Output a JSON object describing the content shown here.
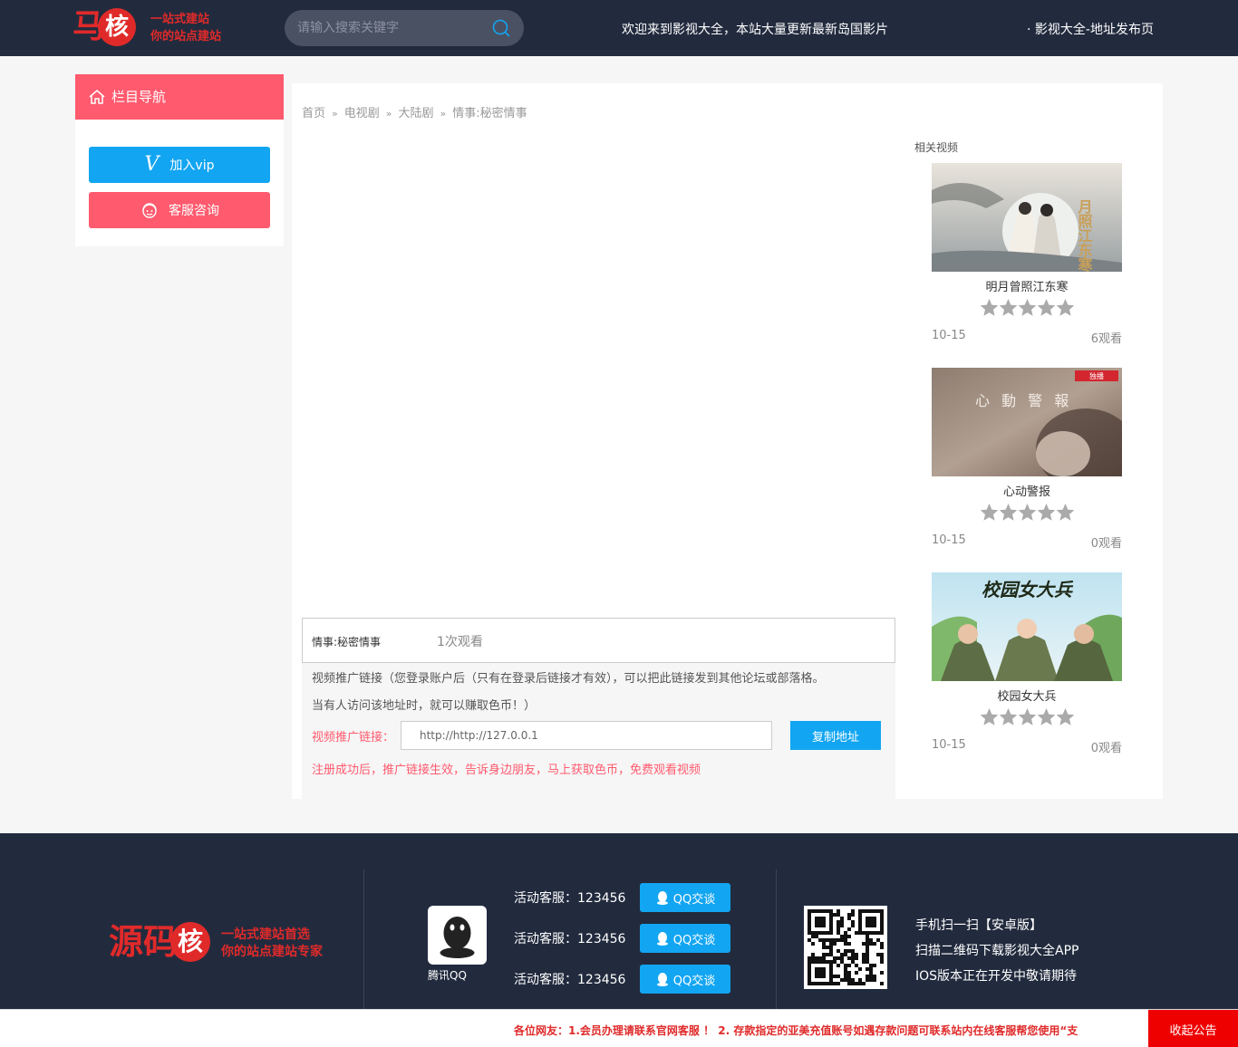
{
  "header": {
    "logo_char1": "马",
    "logo_char2": "核",
    "slogan1": "一站式建站",
    "slogan2": "你的站点建站",
    "search_placeholder": "请输入搜索关键字",
    "welcome": "欢迎来到影视大全，本站大量更新最新岛国影片",
    "release_link": "· 影视大全-地址发布页"
  },
  "sidebar": {
    "title": "栏目导航",
    "vip_button": "加入vip",
    "service_button": "客服咨询"
  },
  "breadcrumb": [
    "首页",
    "电视剧",
    "大陆剧",
    "情事:秘密情事"
  ],
  "video": {
    "title": "情事:秘密情事",
    "views": "1次观看"
  },
  "promo": {
    "line1": "视频推广链接（您登录账户后（只有在登录后链接才有效），可以把此链接发到其他论坛或部落格。",
    "line2": "当有人访问该地址时，就可以赚取色币！）",
    "label": "视频推广链接：",
    "url": "http://http://127.0.0.1",
    "copy_button": "复制地址",
    "note": "注册成功后，推广链接生效，告诉身边朋友，马上获取色币，免费观看视频"
  },
  "related": {
    "title": "相关视频",
    "items": [
      {
        "name": "明月曾照江东寒",
        "date": "10-15",
        "views": "6观看",
        "poster_text": "月照江东寒",
        "rating": 0
      },
      {
        "name": "心动警报",
        "date": "10-15",
        "views": "0观看",
        "poster_text": "心 動 警 報",
        "rating": 0
      },
      {
        "name": "校园女大兵",
        "date": "10-15",
        "views": "0观看",
        "poster_text": "校园女大兵",
        "rating": 0
      }
    ]
  },
  "footer": {
    "logo_text": "源码",
    "logo_circle": "核",
    "slogan1": "一站式建站首选",
    "slogan2": "你的站点建站专家",
    "qq_label": "腾讯QQ",
    "services": [
      {
        "label": "活动客服：123456",
        "button": "QQ交谈"
      },
      {
        "label": "活动客服：123456",
        "button": "QQ交谈"
      },
      {
        "label": "活动客服：123456",
        "button": "QQ交谈"
      }
    ],
    "app_lines": [
      "手机扫一扫【安卓版】",
      "扫描二维码下载影视大全APP",
      "IOS版本正在开发中敬请期待"
    ]
  },
  "notice": {
    "message": "各位网友：1.会员办理请联系官网客服 ！ 2. 存款指定的亚美充值账号如遇存款问题可联系站内在线客服帮您使用“支",
    "collapse": "收起公告"
  },
  "colors": {
    "header_bg": "#222b3e",
    "accent_red": "#ff5a6e",
    "accent_blue": "#12a5f2",
    "logo_red": "#e02a2a"
  }
}
